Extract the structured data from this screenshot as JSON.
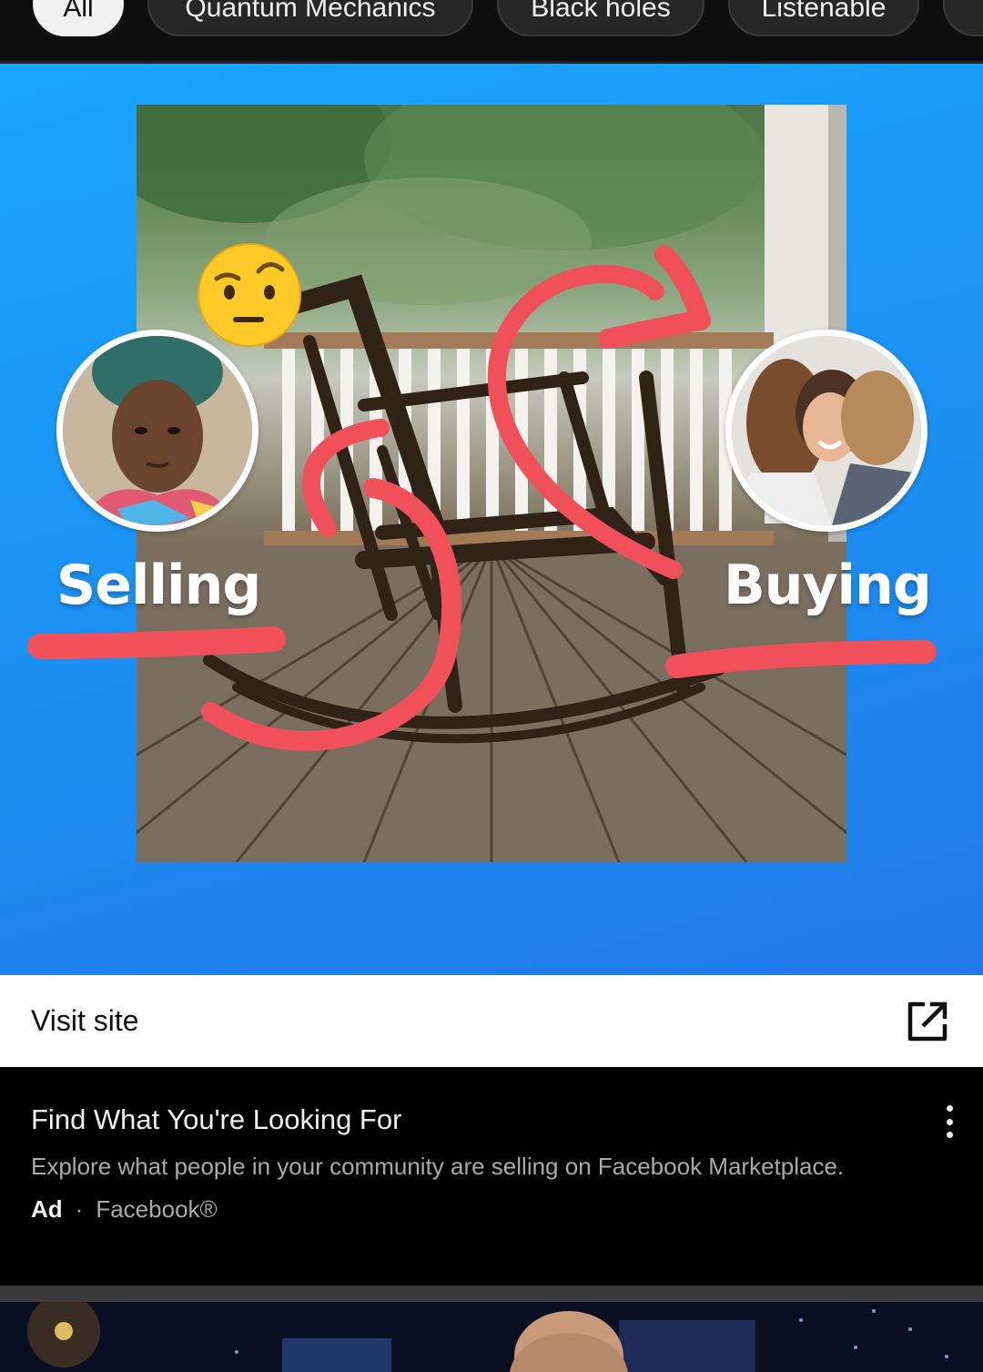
{
  "chips": [
    {
      "label": "All",
      "active": true
    },
    {
      "label": "Quantum Mechanics",
      "active": false
    },
    {
      "label": "Black holes",
      "active": false
    },
    {
      "label": "Listenable",
      "active": false
    },
    {
      "label": "",
      "active": false
    }
  ],
  "creative": {
    "left_label": "Selling",
    "right_label": "Buying",
    "emoji": "raised-eyebrow-face-emoji"
  },
  "visit": {
    "label": "Visit site",
    "icon": "open-in-new-icon"
  },
  "ad": {
    "title": "Find What You're Looking For",
    "description": "Explore what people in your community are selling on Facebook Marketplace.",
    "badge": "Ad",
    "separator": "·",
    "advertiser": "Facebook®",
    "menu_icon": "more-vert-icon"
  },
  "colors": {
    "creative_blue": "#1b8ff2",
    "scribble_red": "#f0505a",
    "chip_bg": "#272727",
    "chip_active_bg": "#f1f1f1"
  }
}
